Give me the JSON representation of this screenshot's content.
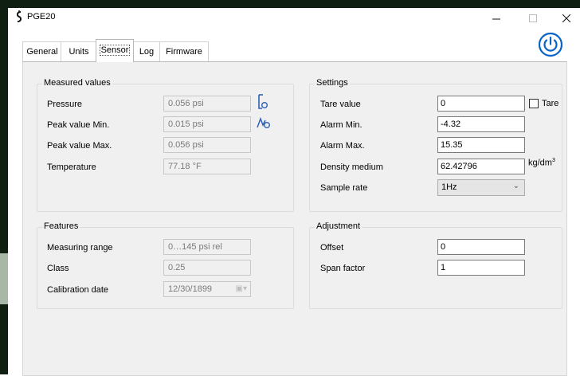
{
  "window": {
    "title": "PGE20"
  },
  "tabs": [
    {
      "label": "General",
      "active": false
    },
    {
      "label": "Units",
      "active": false
    },
    {
      "label": "Sensor",
      "active": true
    },
    {
      "label": "Log",
      "active": false
    },
    {
      "label": "Firmware",
      "active": false
    }
  ],
  "measured": {
    "title": "Measured values",
    "pressure_label": "Pressure",
    "pressure_value": "0.056 psi",
    "peak_min_label": "Peak value Min.",
    "peak_min_value": "0.015 psi",
    "peak_max_label": "Peak value Max.",
    "peak_max_value": "0.056 psi",
    "temperature_label": "Temperature",
    "temperature_value": "77.18 °F"
  },
  "settings": {
    "title": "Settings",
    "tare_label": "Tare value",
    "tare_value": "0",
    "tare_checkbox_label": "Tare",
    "alarm_min_label": "Alarm Min.",
    "alarm_min_value": "-4.32",
    "alarm_max_label": "Alarm Max.",
    "alarm_max_value": "15.35",
    "density_label": "Density medium",
    "density_value": "62.42796",
    "density_unit": "kg/dm",
    "density_unit_sup": "3",
    "sample_rate_label": "Sample rate",
    "sample_rate_value": "1Hz"
  },
  "features": {
    "title": "Features",
    "range_label": "Measuring range",
    "range_value": "0…145 psi rel",
    "class_label": "Class",
    "class_value": "0.25",
    "calibration_label": "Calibration date",
    "calibration_value": "12/30/1899"
  },
  "adjustment": {
    "title": "Adjustment",
    "offset_label": "Offset",
    "offset_value": "0",
    "span_label": "Span factor",
    "span_value": "1"
  },
  "colors": {
    "accent": "#0a64c8",
    "panel": "#f0f0f0"
  }
}
